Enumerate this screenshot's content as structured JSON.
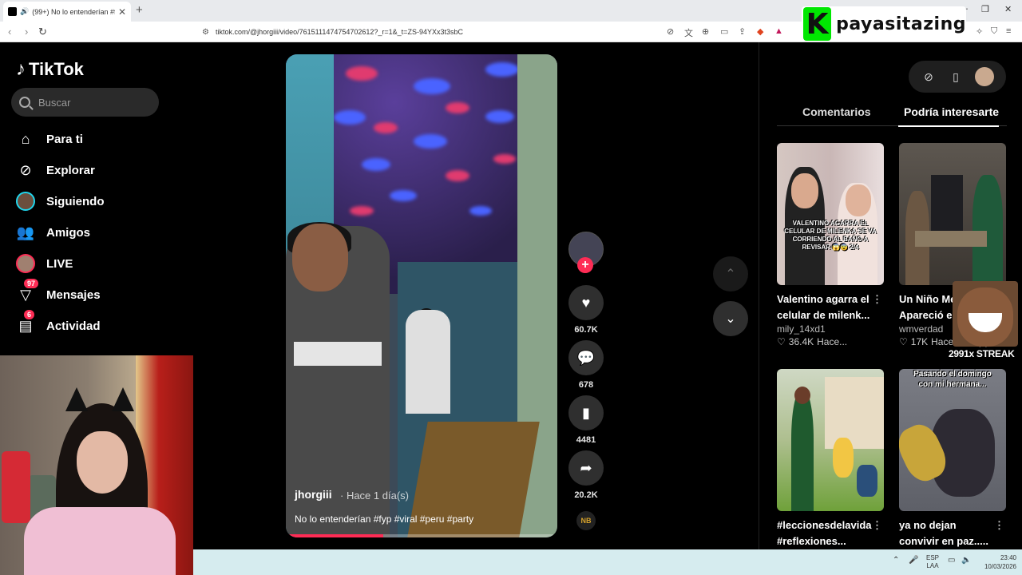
{
  "browser": {
    "tab_title": "(99+) No lo entenderían #fyp",
    "url": "tiktok.com/@jhorgiii/video/7615111474754702612?_r=1&_t=ZS-94YXx3t3sbC",
    "new_tab_glyph": "+",
    "tab_close_glyph": "✕"
  },
  "overlay_logo": {
    "letter": "K",
    "name": "payasitazing",
    "brand_color": "#00e701"
  },
  "sidebar": {
    "brand": "TikTok",
    "search_placeholder": "Buscar",
    "items": [
      {
        "label": "Para ti",
        "icon": "home-icon"
      },
      {
        "label": "Explorar",
        "icon": "compass-icon"
      },
      {
        "label": "Siguiendo",
        "icon": "following-avatar-icon"
      },
      {
        "label": "Amigos",
        "icon": "friends-icon"
      },
      {
        "label": "LIVE",
        "icon": "live-avatar-icon"
      },
      {
        "label": "Mensajes",
        "icon": "messages-icon",
        "badge": "97"
      },
      {
        "label": "Actividad",
        "icon": "activity-icon",
        "badge": "6"
      }
    ]
  },
  "video": {
    "username": "jhorgiii",
    "time": "· Hace 1 día(s)",
    "description": "No lo entenderían #fyp #viral #peru #party",
    "progress": 0.36
  },
  "actions": {
    "likes": "60.7K",
    "comments": "678",
    "saves": "4481",
    "shares": "20.2K",
    "follow_glyph": "+",
    "music_label": "NB"
  },
  "right_panel": {
    "tabs": [
      "Comentarios",
      "Podría interesarte"
    ],
    "active_tab": "Podría interesarte",
    "cards": [
      {
        "caption": "Valentino agarra el celular de milenk...",
        "author": "mily_14xd1",
        "likes": "36.4K",
        "time": "Hace...",
        "overlay_text": "VALENTINO AGARRA EL CELULAR DE MILENKA SE VA CORRIENDO AL BAÑO A REVISAR 😱😨 2/4"
      },
      {
        "caption": "Un Niño Me... Apareció e...",
        "author": "wmverdad",
        "likes": "17K",
        "time": "Hace 2 día(s)",
        "overlay_text": ""
      },
      {
        "caption": "#leccionesdelavida #reflexiones...",
        "author": "",
        "likes": "",
        "time": "",
        "overlay_text": ""
      },
      {
        "caption": "ya no dejan convivir en paz.....",
        "author": "",
        "likes": "",
        "time": "",
        "overlay_text": "Pasando el domingo con mi hermana..."
      }
    ]
  },
  "stream_overlay": {
    "streak": "2991x STREAK"
  },
  "taskbar": {
    "lang": "ESP",
    "layout": "LAA",
    "time": "23:40",
    "date": "10/03/2026"
  },
  "colors": {
    "accent": "#fe2c55",
    "background": "#000000"
  }
}
